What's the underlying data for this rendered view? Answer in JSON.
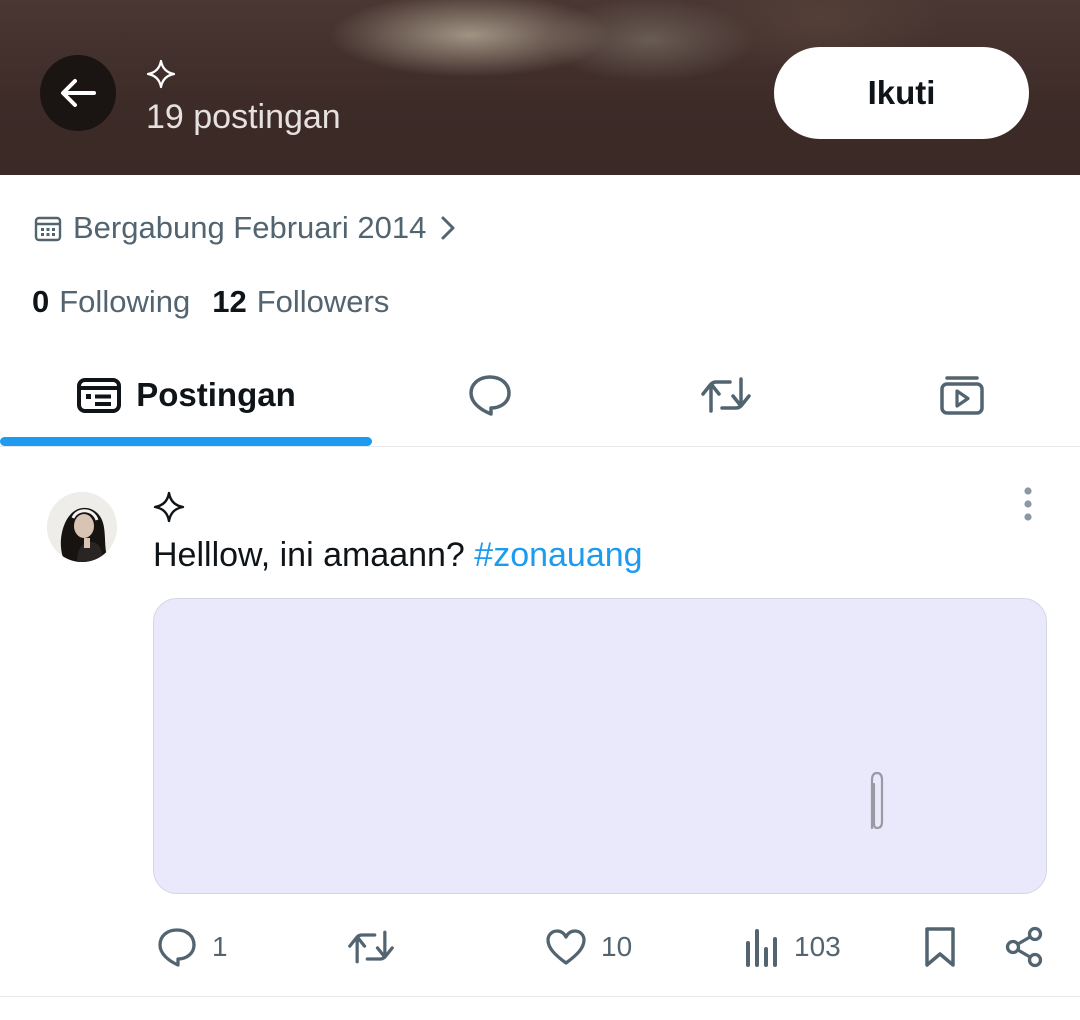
{
  "header": {
    "post_count": "19 postingan",
    "follow_label": "Ikuti",
    "back_icon": "arrow-left-icon",
    "badge_icon": "sparkle-icon"
  },
  "profile": {
    "joined": "Bergabung Februari 2014",
    "following_count": "0",
    "following_label": "Following",
    "followers_count": "12",
    "followers_label": "Followers"
  },
  "tabs": [
    {
      "label": "Postingan",
      "icon": "posts-icon",
      "active": true
    },
    {
      "label": "",
      "icon": "reply-bubble-icon",
      "active": false
    },
    {
      "label": "",
      "icon": "repost-icon",
      "active": false
    },
    {
      "label": "",
      "icon": "media-play-icon",
      "active": false
    }
  ],
  "post": {
    "text": "Helllow, ini amaann?",
    "hashtag": "#zonauang",
    "actions": {
      "replies": "1",
      "likes": "10",
      "views": "103"
    }
  },
  "colors": {
    "accent": "#1d9bf0",
    "header_bg": "#3d2b28",
    "media_bg": "#e9e9fb",
    "secondary_text": "#536471"
  }
}
